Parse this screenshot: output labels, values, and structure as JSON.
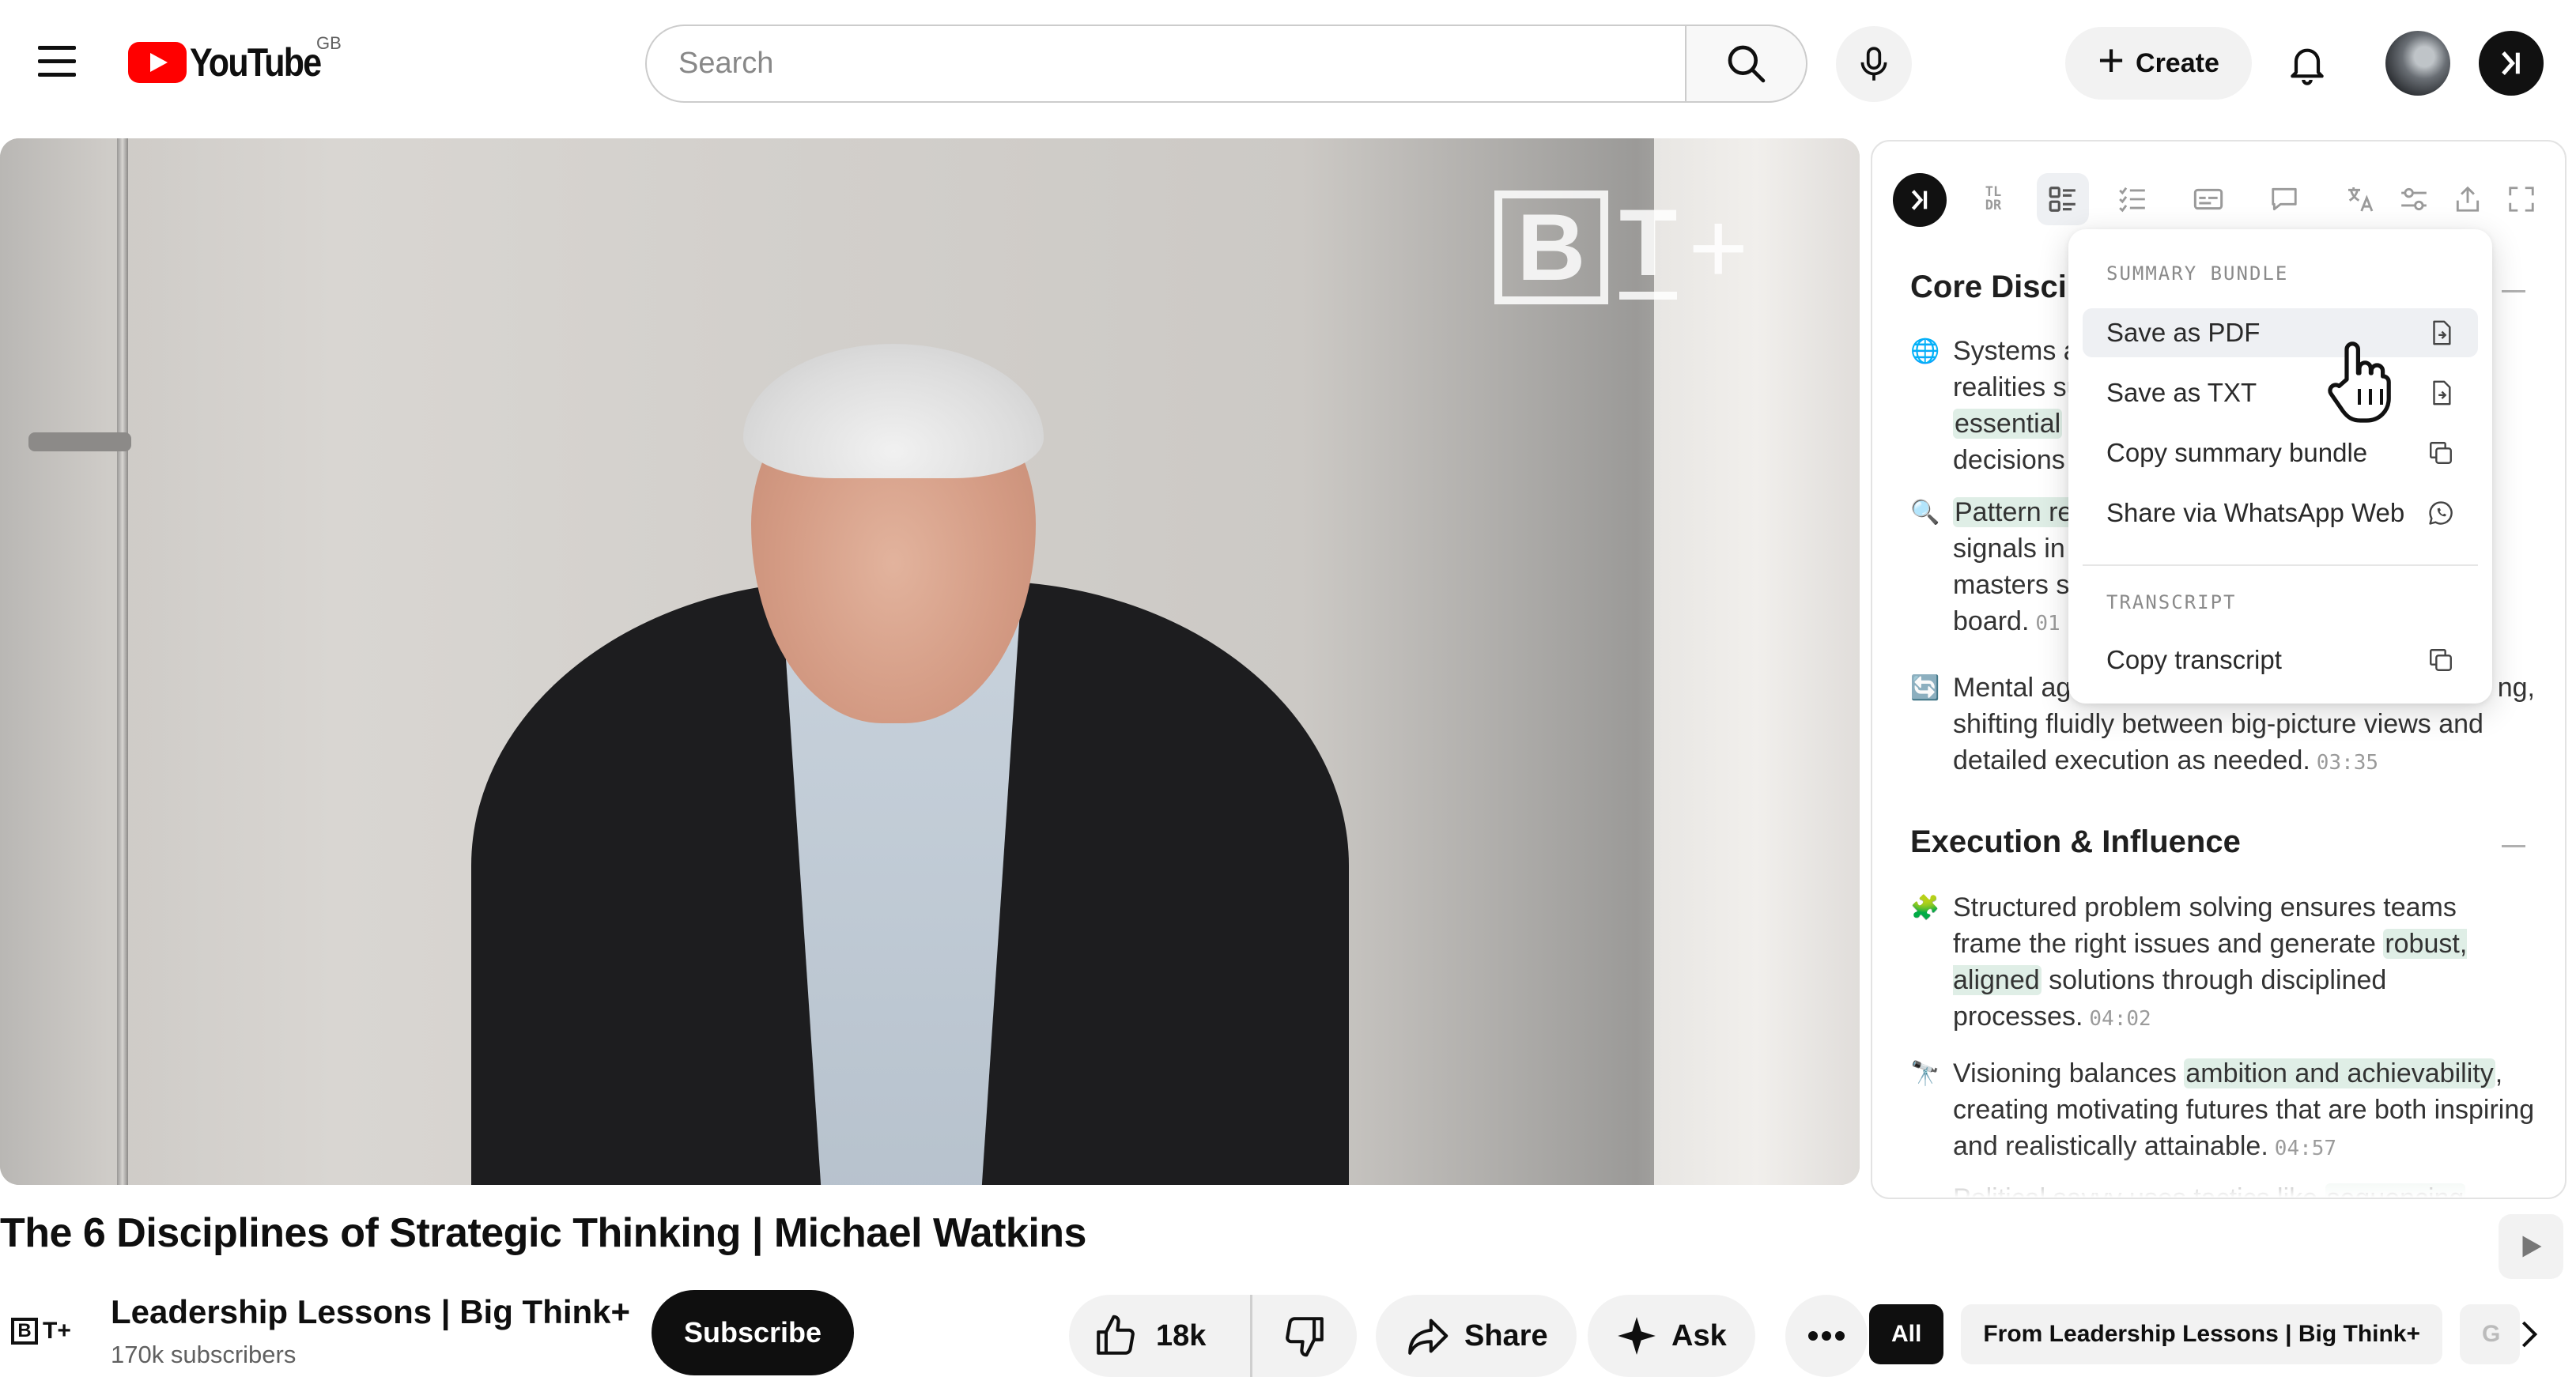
{
  "header": {
    "logo_text": "YouTube",
    "country_code": "GB",
    "search_placeholder": "Search",
    "create_label": "Create"
  },
  "video": {
    "watermark_b": "B",
    "watermark_t": "T",
    "watermark_plus": "+",
    "title": "The 6 Disciplines of Strategic Thinking | Michael Watkins"
  },
  "channel": {
    "logo_b": "B",
    "logo_t": "T+",
    "name": "Leadership Lessons | Big Think+",
    "subscribers": "170k subscribers",
    "subscribe_label": "Subscribe"
  },
  "actions": {
    "like_count": "18k",
    "share_label": "Share",
    "ask_label": "Ask"
  },
  "chips": [
    "All",
    "From Leadership Lessons | Big Think+",
    "G"
  ],
  "panel": {
    "toolbar_tldr": [
      "TL",
      "DR"
    ],
    "sections": [
      {
        "title": "Core Disci",
        "bullets": [
          {
            "icon": "🌐",
            "lines": [
              "Systems a",
              "realities su",
              "essential",
              "decisions"
            ]
          },
          {
            "icon": "🔍",
            "lines": [
              "Pattern re",
              "signals in",
              "masters s",
              "board."
            ],
            "timestamp": "01"
          },
          {
            "icon": "🔄",
            "pre": "Mental ag",
            "post": "ng,",
            "rest": "shifting fluidly between big-picture views and detailed execution as needed.",
            "timestamp": "03:35"
          }
        ]
      },
      {
        "title": "Execution & Influence",
        "bullets": [
          {
            "icon": "🧩",
            "text_a": "Structured problem solving ensures teams frame the right issues and generate ",
            "highlight": "robust, aligned",
            "text_b": " solutions through disciplined processes.",
            "timestamp": "04:02"
          },
          {
            "icon": "🔭",
            "text_a": "Visioning balances ",
            "highlight": "ambition and achievability",
            "text_b": ", creating motivating futures that are both inspiring and realistically attainable.",
            "timestamp": "04:57"
          },
          {
            "icon": "",
            "text_a": "Political savvy uses tactics like ",
            "highlight": "sequencing",
            "text_b": ""
          }
        ]
      }
    ]
  },
  "menu": {
    "summary_header": "SUMMARY BUNDLE",
    "items": [
      "Save as PDF",
      "Save as TXT",
      "Copy summary bundle",
      "Share via WhatsApp Web"
    ],
    "transcript_header": "TRANSCRIPT",
    "transcript_item": "Copy transcript"
  },
  "colors": {
    "brand_red": "#ff0000",
    "highlight": "#dfeee6",
    "subscribe_bg": "#0f0f0f"
  }
}
